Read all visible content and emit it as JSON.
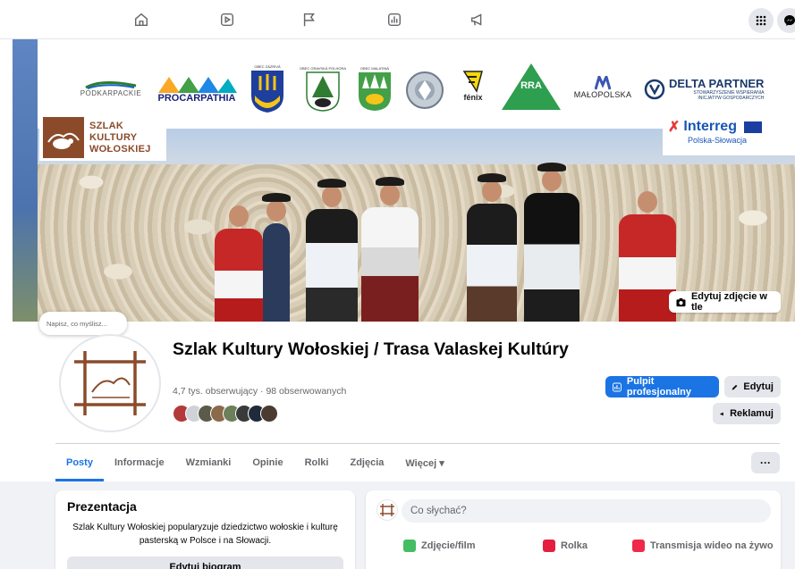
{
  "colors": {
    "accent": "#1b74e4",
    "brand_brown": "#8b4b2a",
    "muted": "#65676b",
    "bg": "#f0f2f5"
  },
  "topbar": {
    "icons": [
      "home-icon",
      "video-icon",
      "flag-icon",
      "analytics-icon",
      "megaphone-icon",
      "apps-menu-icon",
      "messenger-icon"
    ]
  },
  "cover": {
    "logos": [
      "PODKARPACKIE",
      "PROCARPATHIA",
      "OBEC ZÁZRIVÁ",
      "OBEC ORAVSKÁ POLHORA",
      "OBEC MALATINÁ",
      "fénix",
      "RRA SVIDNÍK",
      "MAŁOPOLSKA",
      "DELTA PARTNER",
      "STOWARZYSZENIE WSPIERANIA INICJATYW GOSPODARCZYCH"
    ],
    "brand_lines": [
      "SZLAK",
      "KULTURY",
      "WOŁOSKIEJ"
    ],
    "interreg": {
      "name": "Interreg",
      "program": "Polska-Słowacja"
    },
    "edit_button": "Edytuj zdjęcie w tle"
  },
  "note_placeholder": "Napisz, co myślisz...",
  "profile": {
    "title": "Szlak Kultury Wołoskiej / Trasa Valaskej Kultúry",
    "followers": "4,7 tys. obserwujący · 98 obserwowanych"
  },
  "buttons": {
    "dashboard": "Pulpit profesjonalny",
    "edit": "Edytuj",
    "advertise": "Reklamuj",
    "more": "···"
  },
  "tabs": [
    {
      "label": "Posty",
      "active": true
    },
    {
      "label": "Informacje",
      "active": false
    },
    {
      "label": "Wzmianki",
      "active": false
    },
    {
      "label": "Opinie",
      "active": false
    },
    {
      "label": "Rolki",
      "active": false
    },
    {
      "label": "Zdjęcia",
      "active": false
    },
    {
      "label": "Więcej ▾",
      "active": false
    }
  ],
  "intro": {
    "title": "Prezentacja",
    "text": "Szlak Kultury Wołoskiej popularyzuje dziedzictwo wołoskie i kulturę pasterską w Polsce i na Słowacji.",
    "edit_bio": "Edytuj biogram"
  },
  "composer": {
    "placeholder": "Co słychać?",
    "actions": [
      {
        "label": "Zdjęcie/film",
        "color": "#45bd62"
      },
      {
        "label": "Rolka",
        "color": "#e41e3f"
      },
      {
        "label": "Transmisja wideo na żywo",
        "color": "#f02849"
      }
    ]
  }
}
